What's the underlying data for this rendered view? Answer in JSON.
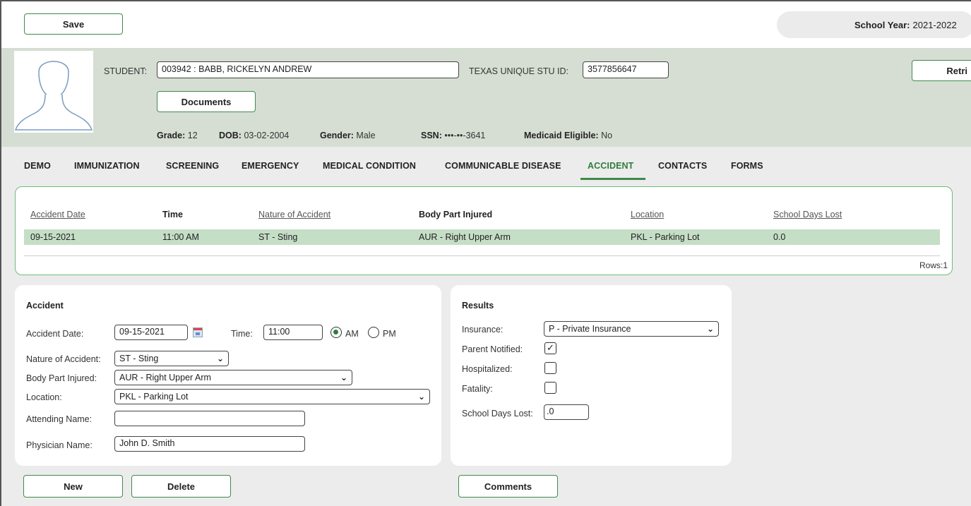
{
  "toolbar": {
    "save_label": "Save",
    "school_year_label": "School Year:",
    "school_year_value": "2021-2022"
  },
  "student": {
    "student_label": "STUDENT:",
    "student_value": "003942 : BABB, RICKELYN ANDREW",
    "unique_id_label": "TEXAS UNIQUE STU ID:",
    "unique_id_value": "3577856647",
    "retrieve_label": "Retri",
    "documents_label": "Documents",
    "grade_label": "Grade:",
    "grade_value": "12",
    "dob_label": "DOB:",
    "dob_value": "03-02-2004",
    "gender_label": "Gender:",
    "gender_value": "Male",
    "ssn_label": "SSN:",
    "ssn_value": "•••-••-3641",
    "medicaid_label": "Medicaid Eligible:",
    "medicaid_value": "No"
  },
  "tabs": [
    "DEMO",
    "IMMUNIZATION",
    "SCREENING",
    "EMERGENCY",
    "MEDICAL CONDITION",
    "COMMUNICABLE DISEASE",
    "ACCIDENT",
    "CONTACTS",
    "FORMS"
  ],
  "active_tab": "ACCIDENT",
  "grid": {
    "headers": [
      "Accident Date",
      "Time",
      "Nature of Accident",
      "Body Part Injured",
      "Location",
      "School Days Lost"
    ],
    "rows": [
      [
        "09-15-2021",
        "11:00 AM",
        "ST - Sting",
        "AUR - Right Upper Arm",
        "PKL - Parking Lot",
        "0.0"
      ]
    ],
    "rows_label": "Rows:1"
  },
  "accident": {
    "title": "Accident",
    "date_label": "Accident Date:",
    "date_value": "09-15-2021",
    "time_label": "Time:",
    "time_value": "11:00",
    "am_label": "AM",
    "pm_label": "PM",
    "nature_label": "Nature of Accident:",
    "nature_value": "ST - Sting",
    "body_label": "Body Part Injured:",
    "body_value": "AUR - Right Upper Arm",
    "location_label": "Location:",
    "location_value": "PKL - Parking Lot",
    "attending_label": "Attending Name:",
    "attending_value": "",
    "physician_label": "Physician Name:",
    "physician_value": "John D. Smith"
  },
  "results": {
    "title": "Results",
    "insurance_label": "Insurance:",
    "insurance_value": "P - Private Insurance",
    "parent_label": "Parent Notified:",
    "parent_checked": "✓",
    "hospitalized_label": "Hospitalized:",
    "fatality_label": "Fatality:",
    "days_lost_label": "School Days Lost:",
    "days_lost_value": ".0"
  },
  "buttons": {
    "new_label": "New",
    "delete_label": "Delete",
    "comments_label": "Comments"
  },
  "colors": {
    "accent": "#3a8a4a",
    "header_bg": "#d6ded3",
    "row_highlight": "#c5dec6"
  }
}
